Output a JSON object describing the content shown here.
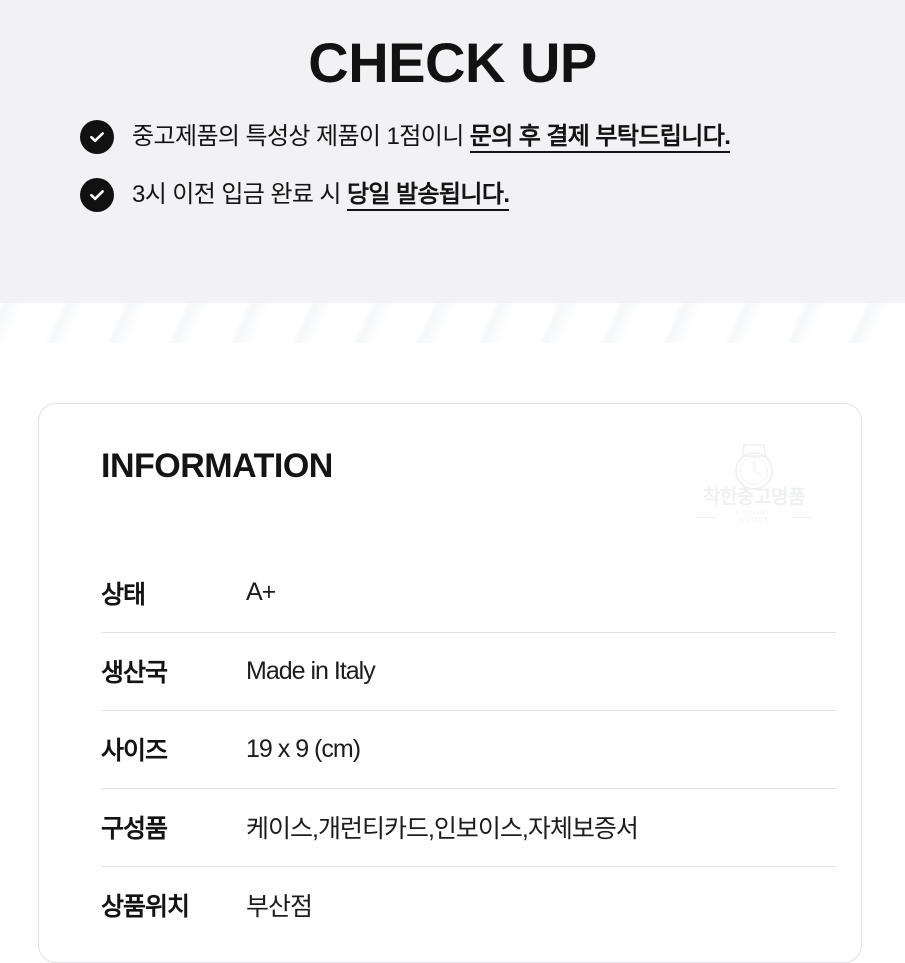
{
  "checkup": {
    "title": "CHECK UP",
    "items": [
      {
        "icon": "check-circle-icon",
        "normal_before": "중고제품의 특성상 제품이 1점이니 ",
        "emphasis": "문의 후 결제 부탁드립니다.",
        "normal_after": ""
      },
      {
        "icon": "check-circle-icon",
        "normal_before": "3시 이전 입금 완료 시 ",
        "emphasis": "당일 발송됩니다.",
        "normal_after": ""
      }
    ]
  },
  "information": {
    "title": "INFORMATION",
    "watermark": {
      "icon": "watch-icon",
      "brand": "착한중고명품",
      "subtitle": "LUXURY GOODS"
    },
    "rows": [
      {
        "label": "상태",
        "value": "A+"
      },
      {
        "label": "생산국",
        "value": "Made in Italy"
      },
      {
        "label": "사이즈",
        "value": "19 x 9 (cm)"
      },
      {
        "label": "구성품",
        "value": "케이스,개런티카드,인보이스,자체보증서"
      },
      {
        "label": "상품위치",
        "value": "부산점"
      }
    ]
  },
  "colors": {
    "banner_background": "#f2f2f4",
    "page_background": "#ffffff",
    "text": "#141414",
    "icon_fill": "#111111",
    "divider": "#e4e4e6",
    "card_border": "#e2e2e4"
  }
}
